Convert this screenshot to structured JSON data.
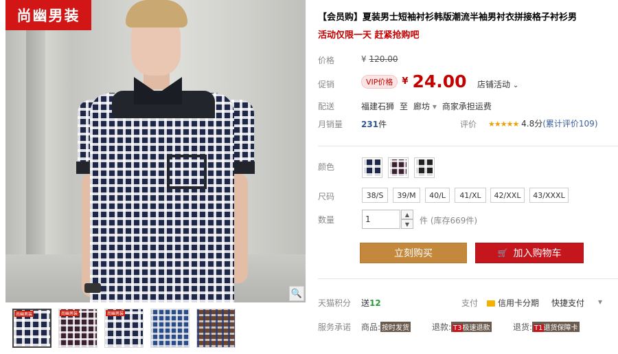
{
  "brand_logo": "尚幽男装",
  "product": {
    "title": "【会员购】夏装男士短袖衬衫韩版潮流半袖男衬衣拼接格子衬衫男",
    "promo": "活动仅限一天 赶紧抢购吧"
  },
  "price": {
    "label": "价格",
    "currency": "¥",
    "original": "120.00"
  },
  "promo_price": {
    "label": "促销",
    "vip_badge": "VIP价格",
    "currency": "¥",
    "value": "24.00",
    "store_activity": "店铺活动",
    "store_activity_caret": "⌄"
  },
  "shipping": {
    "label": "配送",
    "from": "福建石狮",
    "to_word": "至",
    "destination": "廊坊",
    "destination_caret": "▾",
    "fee": "商家承担运费"
  },
  "sales": {
    "label": "月销量",
    "count": "231",
    "unit": "件",
    "rating_label": "评价",
    "stars": "★★★★★",
    "score": "4.8分",
    "review_text": "(累计评价109)"
  },
  "color": {
    "label": "颜色",
    "options": [
      "blue-plaid",
      "red-plaid",
      "black-plaid"
    ]
  },
  "size": {
    "label": "尺码",
    "options": [
      "38/S",
      "39/M",
      "40/L",
      "41/XL",
      "42/XXL",
      "43/XXXL"
    ]
  },
  "quantity": {
    "label": "数量",
    "value": "1",
    "up": "▲",
    "down": "▼",
    "unit": "件",
    "stock": "(库存669件)"
  },
  "buttons": {
    "buy_now": "立刻购买",
    "add_cart": "加入购物车",
    "cart_icon": "🛒"
  },
  "points": {
    "label": "天猫积分",
    "send_word": "送",
    "value": "12"
  },
  "payment": {
    "label": "支付",
    "credit_card": "信用卡分期",
    "quick_pay": "快捷支付",
    "caret": "▾"
  },
  "services": {
    "label": "服务承诺",
    "items": [
      {
        "prefix": "商品:",
        "tag": "按时发货"
      },
      {
        "prefix": "退款:",
        "tag_num": "T3",
        "tag": "极速退款"
      },
      {
        "prefix": "退货:",
        "tag_num": "T1",
        "tag": "退货保障卡"
      }
    ]
  },
  "gallery": {
    "zoom_icon": "🔍",
    "thumb_labels": [
      "尚幽男装",
      "尚幽男装",
      "尚幽男装"
    ]
  },
  "colors": {
    "accent_red": "#c40000",
    "buy_button": "#c4883c",
    "cart_button": "#c4161c",
    "brand_red": "#d21616"
  }
}
